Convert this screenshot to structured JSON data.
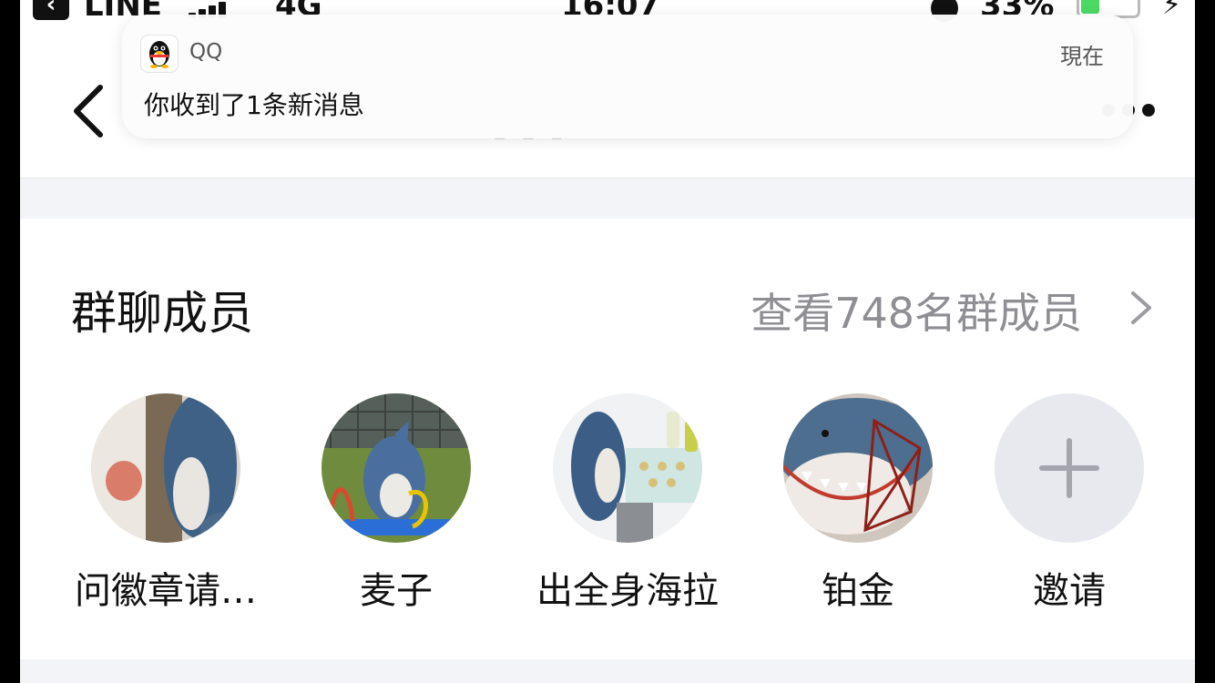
{
  "status_bar": {
    "back_app": "LINE",
    "network": "4G",
    "time": "16:07",
    "battery_percent": "33%",
    "battery_level": 0.33,
    "battery_color": "#4cd964"
  },
  "notification": {
    "app_name": "QQ",
    "time": "現在",
    "message": "你收到了1条新消息",
    "icon": "qq-penguin-icon"
  },
  "nav": {
    "back_icon": "chevron-left-icon",
    "more_icon": "more-dots-icon"
  },
  "members_section": {
    "title": "群聊成员",
    "view_all": "查看748名群成员",
    "view_all_icon": "chevron-right-icon",
    "members": [
      {
        "name": "问徽章请…",
        "avatar": "shark-plush-photo"
      },
      {
        "name": "麦子",
        "avatar": "shark-plush-photo"
      },
      {
        "name": "出全身海拉",
        "avatar": "shark-plush-photo"
      },
      {
        "name": "铂金",
        "avatar": "shark-plush-photo"
      }
    ],
    "invite_label": "邀请",
    "invite_icon": "plus-icon"
  },
  "colors": {
    "page_background": "#f3f4f7",
    "secondary_text": "#8e8e93",
    "invite_circle": "#e8e9ef"
  }
}
